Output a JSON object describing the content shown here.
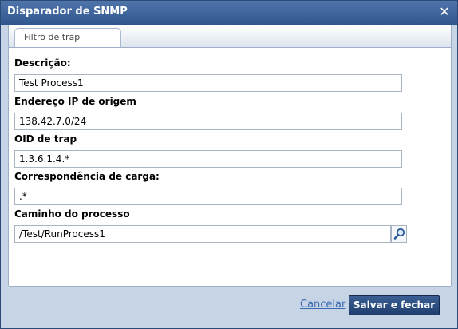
{
  "dialog": {
    "title": "Disparador de SNMP",
    "close_icon": "close-icon"
  },
  "tabs": [
    {
      "label": "Filtro de trap",
      "active": true
    }
  ],
  "form": {
    "description": {
      "label": "Descrição:",
      "value": "Test Process1"
    },
    "source_ip": {
      "label": "Endereço IP de origem",
      "value": "138.42.7.0/24"
    },
    "trap_oid": {
      "label": "OID de trap",
      "value": "1.3.6.1.4.*"
    },
    "payload_match": {
      "label": "Correspondência de carga:",
      "value": ".*"
    },
    "process_path": {
      "label": "Caminho do processo",
      "value": "/Test/RunProcess1",
      "lookup_icon": "search-icon"
    }
  },
  "footer": {
    "cancel_label": "Cancelar",
    "save_label": "Salvar e fechar"
  },
  "colors": {
    "titlebar": "#3a6299",
    "save_button": "#2a4d80",
    "link": "#3a6ab0"
  }
}
